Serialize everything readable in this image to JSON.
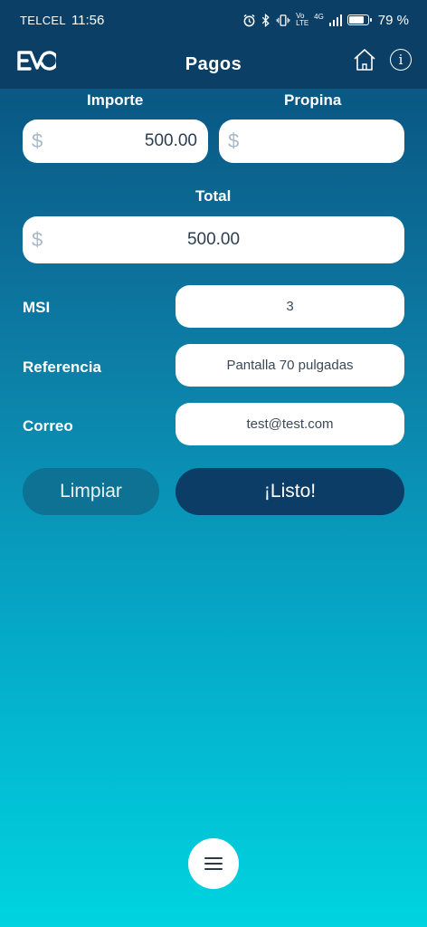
{
  "status_bar": {
    "carrier": "TELCEL",
    "time": "11:56",
    "network": "4G",
    "volte": "Vo LTE",
    "battery_percent": "79 %",
    "battery_level": 0.79
  },
  "header": {
    "logo_text": "EVO",
    "title": "Pagos"
  },
  "form": {
    "importe": {
      "label": "Importe",
      "currency": "$",
      "value": "500.00"
    },
    "propina": {
      "label": "Propina",
      "currency": "$",
      "value": ""
    },
    "total": {
      "label": "Total",
      "currency": "$",
      "value": "500.00"
    },
    "msi": {
      "label": "MSI",
      "value": "3"
    },
    "referencia": {
      "label": "Referencia",
      "value": "Pantalla 70 pulgadas"
    },
    "correo": {
      "label": "Correo",
      "value": "test@test.com"
    }
  },
  "buttons": {
    "clear_label": "Limpiar",
    "done_label": "¡Listo!"
  },
  "colors": {
    "header_bg": "#0b3f66",
    "primary_button": "#0b3d66",
    "secondary_button": "#0d7293",
    "gradient_bottom": "#00d4e0"
  }
}
